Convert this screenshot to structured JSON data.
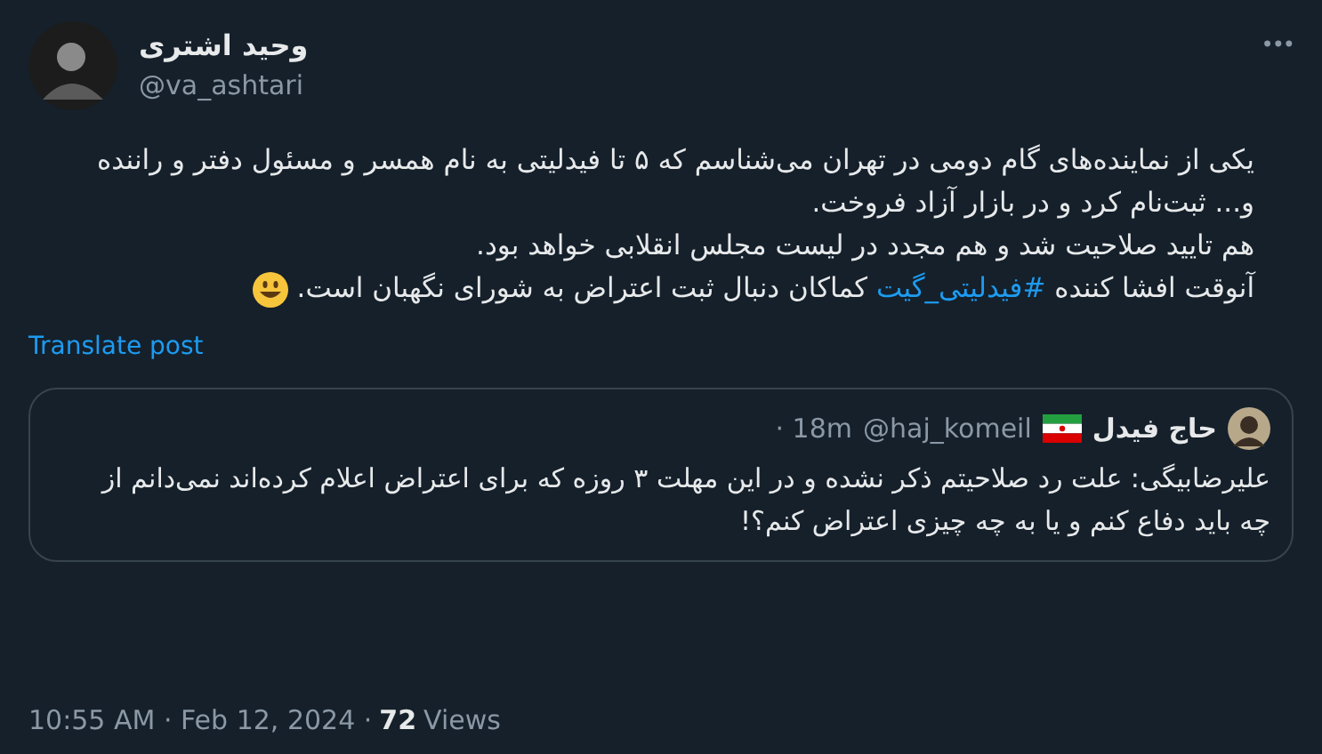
{
  "author": {
    "name": "وحید اشتری",
    "handle": "@va_ashtari"
  },
  "more_button": "•••",
  "body": [
    {
      "segments": [
        {
          "kind": "text",
          "text": "یکی از نماینده‌های گام دومی در تهران می‌شناسم که ۵ تا فیدلیتی به نام همسر و مسئول دفتر و راننده و... ثبت‌نام کرد و در بازار آزاد فروخت."
        }
      ]
    },
    {
      "segments": [
        {
          "kind": "text",
          "text": "هم تایید صلاحیت شد و هم مجدد در لیست مجلس انقلابی خواهد بود."
        }
      ]
    },
    {
      "segments": [
        {
          "kind": "text",
          "text": "آنوقت افشا کننده "
        },
        {
          "kind": "hashtag",
          "text": "#فیدلیتی_گیت"
        },
        {
          "kind": "text",
          "text": " کماکان دنبال ثبت اعتراض به شورای نگهبان است."
        },
        {
          "kind": "emoji"
        }
      ]
    }
  ],
  "translate_link": "Translate post",
  "quote": {
    "name": "حاج فیدل",
    "handle": "@haj_komeil",
    "time": "· 18m",
    "text": "علیرضابیگی: علت رد صلاحیتم ذکر نشده و در این مهلت ۳ روزه که برای اعتراض اعلام کرده‌اند نمی‌دانم از چه باید دفاع کنم و یا به چه چیزی اعتراض کنم؟!"
  },
  "footer": {
    "time": "10:55 AM · Feb 12, 2024 ·",
    "views_count": "72",
    "views_label": "Views"
  }
}
